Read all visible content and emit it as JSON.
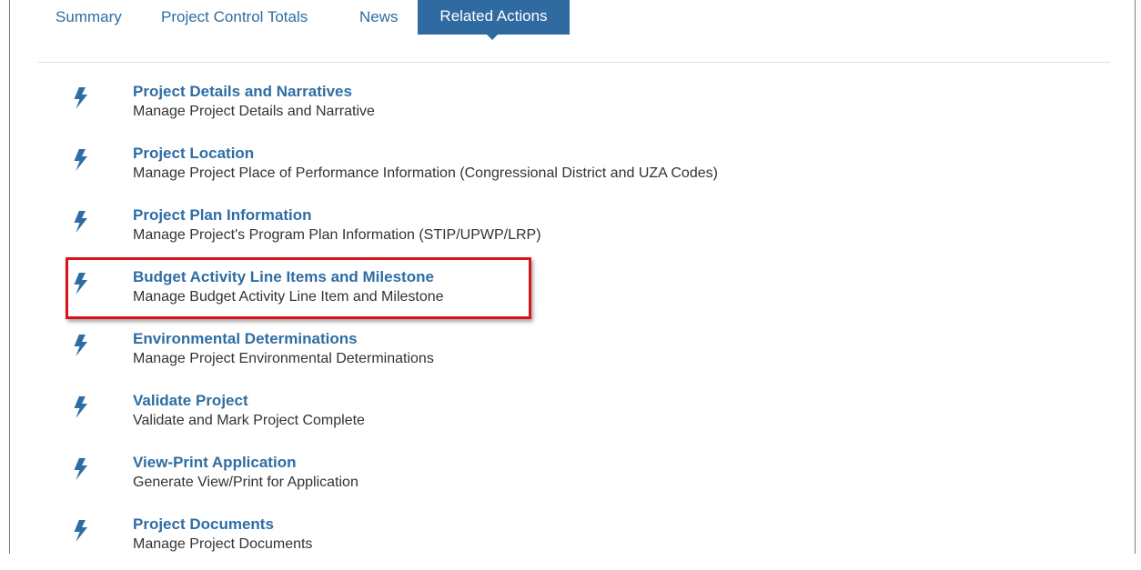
{
  "tabs": [
    {
      "label": "Summary"
    },
    {
      "label": "Project Control Totals"
    },
    {
      "label": "News"
    },
    {
      "label": "Related Actions",
      "active": true
    }
  ],
  "actions": [
    {
      "title": "Project Details and Narratives",
      "description": "Manage Project Details and Narrative"
    },
    {
      "title": "Project Location",
      "description": "Manage Project Place of Performance Information (Congressional District and UZA Codes)"
    },
    {
      "title": "Project Plan Information",
      "description": "Manage Project's Program Plan Information (STIP/UPWP/LRP)"
    },
    {
      "title": "Budget Activity Line Items and Milestone",
      "description": "Manage Budget Activity Line Item and Milestone",
      "highlighted": true
    },
    {
      "title": "Environmental Determinations",
      "description": "Manage Project Environmental Determinations"
    },
    {
      "title": "Validate Project",
      "description": "Validate and Mark Project Complete"
    },
    {
      "title": "View-Print Application",
      "description": "Generate View/Print for Application"
    },
    {
      "title": "Project Documents",
      "description": "Manage Project Documents"
    }
  ],
  "icons": {
    "action_icon": "lightning-bolt-icon"
  },
  "colors": {
    "link": "#2e6da4",
    "active_tab_bg": "#2f6aa1",
    "highlight_border": "#d6161b",
    "text": "#333333"
  }
}
